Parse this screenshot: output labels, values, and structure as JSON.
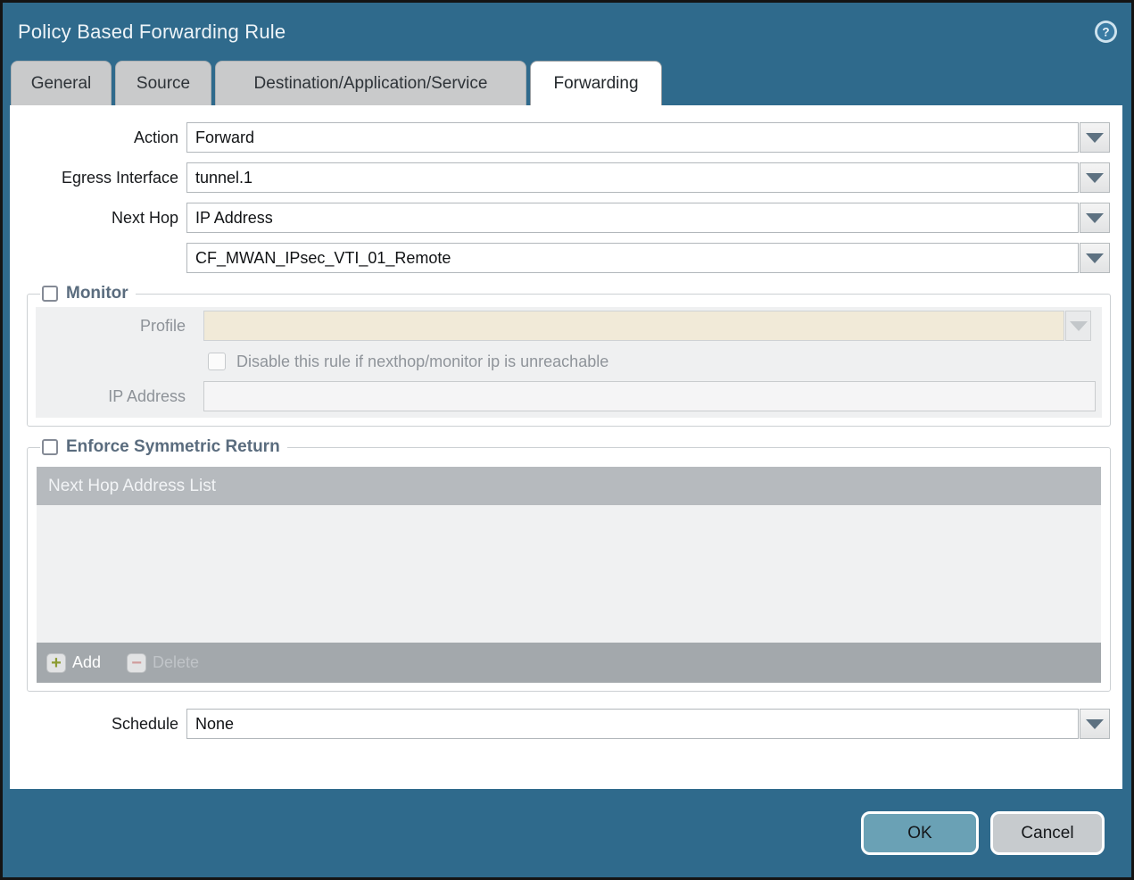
{
  "window": {
    "title": "Policy Based Forwarding Rule"
  },
  "icons": {
    "help_glyph": "?",
    "add_glyph": "+",
    "delete_glyph": "−",
    "chevron": "dropdown-triangle"
  },
  "tabs": [
    {
      "label": "General",
      "active": false
    },
    {
      "label": "Source",
      "active": false
    },
    {
      "label": "Destination/Application/Service",
      "active": false
    },
    {
      "label": "Forwarding",
      "active": true
    }
  ],
  "form": {
    "action": {
      "label": "Action",
      "value": "Forward"
    },
    "egress_interface": {
      "label": "Egress Interface",
      "value": "tunnel.1"
    },
    "next_hop": {
      "label": "Next Hop",
      "value": "IP Address"
    },
    "next_hop_address": {
      "value": "CF_MWAN_IPsec_VTI_01_Remote"
    },
    "schedule": {
      "label": "Schedule",
      "value": "None"
    }
  },
  "monitor": {
    "title": "Monitor",
    "checked": false,
    "profile": {
      "label": "Profile",
      "value": ""
    },
    "disable_rule": {
      "label": "Disable this rule if nexthop/monitor ip is unreachable",
      "checked": false
    },
    "ip_address": {
      "label": "IP Address",
      "value": ""
    }
  },
  "enforce_symmetric_return": {
    "title": "Enforce Symmetric Return",
    "checked": false,
    "table": {
      "header": "Next Hop Address List",
      "rows": []
    },
    "add_label": "Add",
    "delete_label": "Delete"
  },
  "footer": {
    "ok_label": "OK",
    "cancel_label": "Cancel"
  },
  "colors": {
    "titlebar_teal": "#2f6a8c",
    "ok_button": "#6aa1b5",
    "cancel_button": "#c7cbce",
    "disabled_field_cream": "#f1ead8",
    "table_header_gray": "#b6babe",
    "table_footer_gray": "#a3a8ac",
    "legend_text": "#5a6c7e",
    "add_plus_green": "#8c9b31",
    "delete_minus_red": "#d09c9c"
  }
}
